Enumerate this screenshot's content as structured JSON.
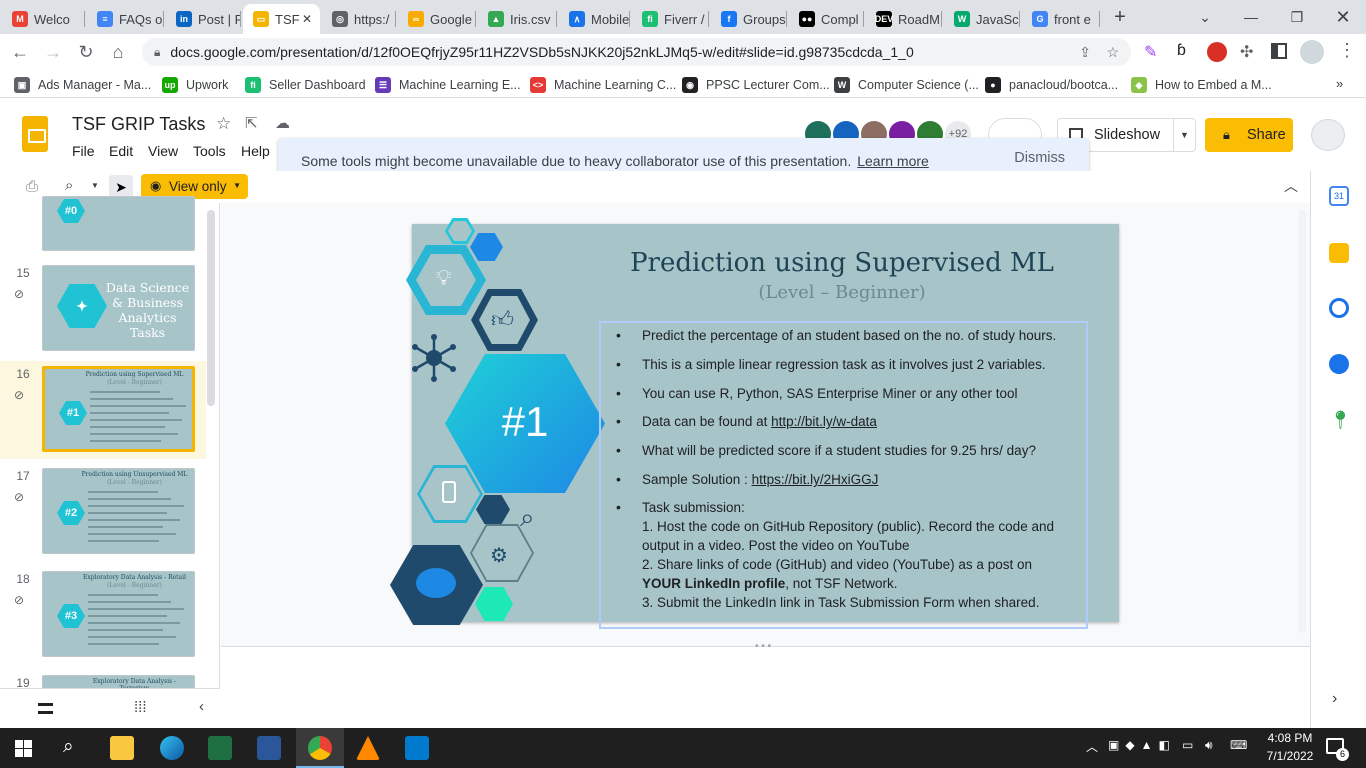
{
  "browser": {
    "tabs": [
      {
        "label": "Welco",
        "icon": "gmail-icon",
        "color": "#ea4335",
        "glyph": "M"
      },
      {
        "label": "FAQs o",
        "icon": "docs-icon",
        "color": "#4285f4",
        "glyph": "≡"
      },
      {
        "label": "Post | F",
        "icon": "linkedin-icon",
        "color": "#0a66c2",
        "glyph": "in"
      },
      {
        "label": "TSF",
        "icon": "slides-icon",
        "color": "#f4b400",
        "glyph": "▭",
        "active": true
      },
      {
        "label": "https:/",
        "icon": "globe-icon",
        "color": "#5f6368",
        "glyph": "◎"
      },
      {
        "label": "Google",
        "icon": "colab-icon",
        "color": "#f9ab00",
        "glyph": "∞"
      },
      {
        "label": "Iris.csv",
        "icon": "drive-icon",
        "color": "#34a853",
        "glyph": "▲"
      },
      {
        "label": "Mobile",
        "icon": "ml-icon",
        "color": "#1a73e8",
        "glyph": "∧"
      },
      {
        "label": "Fiverr /",
        "icon": "fiverr-icon",
        "color": "#1dbf73",
        "glyph": "fi"
      },
      {
        "label": "Groups",
        "icon": "facebook-icon",
        "color": "#1877f2",
        "glyph": "f"
      },
      {
        "label": "Compl",
        "icon": "medium-icon",
        "color": "#000000",
        "glyph": "●●"
      },
      {
        "label": "RoadM",
        "icon": "dev-icon",
        "color": "#000000",
        "glyph": "DEV"
      },
      {
        "label": "JavaSc",
        "icon": "w3schools-icon",
        "color": "#04aa6d",
        "glyph": "W"
      },
      {
        "label": "front e",
        "icon": "google-icon",
        "color": "#4285f4",
        "glyph": "G"
      }
    ],
    "new_tab": "+",
    "url": "docs.google.com/presentation/d/12f0OEQfrjyZ95r11HZ2VSDb5sNJKK20j52nkLJMq5-w/edit#slide=id.g98735cdcda_1_0",
    "bookmarks": [
      {
        "label": "Ads Manager - Ma...",
        "icon": "ads-manager-icon",
        "color": "#5f6368",
        "glyph": "▣"
      },
      {
        "label": "Upwork",
        "icon": "upwork-icon",
        "color": "#14a800",
        "glyph": "up"
      },
      {
        "label": "Seller Dashboard",
        "icon": "fiverr-icon",
        "color": "#1dbf73",
        "glyph": "fi"
      },
      {
        "label": "Machine Learning E...",
        "icon": "ml-course-icon",
        "color": "#673ab7",
        "glyph": "☰"
      },
      {
        "label": "Machine Learning C...",
        "icon": "code-icon",
        "color": "#e53935",
        "glyph": "<>"
      },
      {
        "label": "PPSC Lecturer Com...",
        "icon": "ppsc-icon",
        "color": "#202124",
        "glyph": "◉"
      },
      {
        "label": "Computer Science (...",
        "icon": "wordpress-icon",
        "color": "#3c4043",
        "glyph": "W"
      },
      {
        "label": "panacloud/bootca...",
        "icon": "github-icon",
        "color": "#202124",
        "glyph": "●"
      },
      {
        "label": "How to Embed a M...",
        "icon": "embed-icon",
        "color": "#8bc34a",
        "glyph": "◆"
      }
    ]
  },
  "app": {
    "title": "TSF GRIP  Tasks",
    "menus": [
      "File",
      "Edit",
      "View",
      "Tools",
      "Help"
    ],
    "banner_text": "Some tools might become unavailable due to heavy collaborator use of this presentation.",
    "banner_link": "Learn more",
    "banner_dismiss": "Dismiss",
    "collaborators_more": "+92",
    "slideshow_label": "Slideshow",
    "share_label": "Share",
    "view_mode": "View only"
  },
  "filmstrip": [
    {
      "num": "",
      "title": "",
      "hexlabel": "#0",
      "partial": true
    },
    {
      "num": "15",
      "title": "Data Science & Business Analytics Tasks",
      "hexlabel": ""
    },
    {
      "num": "16",
      "title": "Prediction using Supervised ML",
      "sub": "(Level - Beginner)",
      "hexlabel": "#1",
      "selected": true
    },
    {
      "num": "17",
      "title": "Prediction using Unsupervised ML",
      "sub": "(Level - Beginner)",
      "hexlabel": "#2"
    },
    {
      "num": "18",
      "title": "Exploratory Data Analysis - Retail",
      "sub": "(Level - Beginner)",
      "hexlabel": "#3"
    },
    {
      "num": "19",
      "title": "Exploratory Data Analysis - Terrorism",
      "hexlabel": ""
    }
  ],
  "slide": {
    "title": "Prediction using Supervised ML",
    "subtitle": "(Level – Beginner)",
    "badge": "#1",
    "bullets": [
      "Predict the percentage of an student based on the no. of study hours.",
      "This is a simple linear  regression task as it involves just 2 variables.",
      "You can use R, Python, SAS Enterprise Miner or any other tool",
      {
        "prefix": "Data can be found at ",
        "link": "http://bit.ly/w-data"
      },
      "What will be predicted score if a student studies for 9.25 hrs/ day?",
      {
        "prefix": "Sample Solution : ",
        "link": "https://bit.ly/2HxiGGJ"
      },
      "Task submission:"
    ],
    "submission_lines": [
      "1. Host the code on GitHub Repository (public). Record the code and",
      "output in a video. Post the video on YouTube",
      "2. Share links of code (GitHub) and video (YouTube) as a post on",
      {
        "bold": "YOUR LinkedIn profile",
        "rest": ", not TSF Network."
      },
      "3. Submit the LinkedIn link in Task Submission Form when shared."
    ]
  },
  "taskbar": {
    "time": "4:08 PM",
    "date": "7/1/2022",
    "notification_count": "6"
  }
}
